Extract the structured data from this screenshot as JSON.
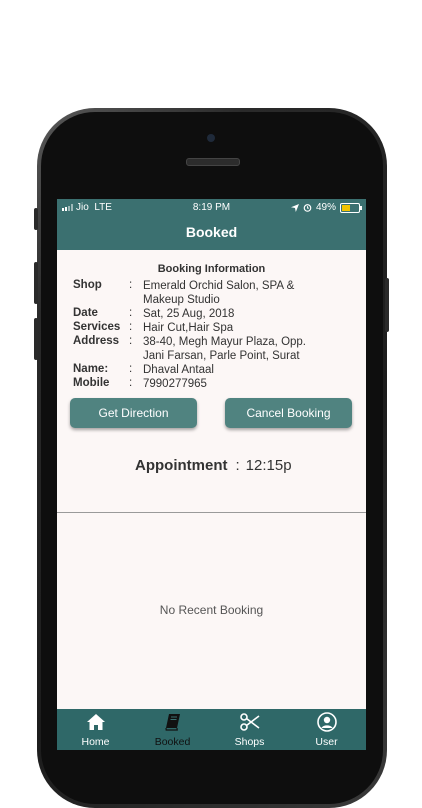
{
  "status": {
    "carrier": "Jio",
    "network": "LTE",
    "time": "8:19 PM",
    "battery": "49%",
    "battery_level": 0.49
  },
  "header": {
    "title": "Booked"
  },
  "booking": {
    "section_title": "Booking Information",
    "rows": [
      {
        "label": "Shop",
        "colon": ":",
        "value": "Emerald Orchid Salon, SPA & Makeup Studio"
      },
      {
        "label": "Date",
        "colon": ":",
        "value": "Sat, 25 Aug, 2018"
      },
      {
        "label": "Services",
        "colon": ":",
        "value": "Hair Cut,Hair Spa"
      },
      {
        "label": "Address",
        "colon": ":",
        "value": "38-40, Megh Mayur Plaza, Opp. Jani Farsan, Parle Point, Surat"
      },
      {
        "label": "Name:",
        "colon": ":",
        "value": "Dhaval Antaal"
      },
      {
        "label": "Mobile",
        "colon": ":",
        "value": "7990277965"
      }
    ],
    "get_direction_label": "Get Direction",
    "cancel_label": "Cancel Booking",
    "appointment_label": "Appointment",
    "appointment_sep": ":",
    "appointment_time": "12:15p"
  },
  "recent": {
    "empty_text": "No Recent Booking"
  },
  "tabs": [
    {
      "label": "Home",
      "icon": "home-icon"
    },
    {
      "label": "Booked",
      "icon": "book-icon"
    },
    {
      "label": "Shops",
      "icon": "scissors-icon"
    },
    {
      "label": "User",
      "icon": "user-icon"
    }
  ],
  "colors": {
    "primary": "#3b7070",
    "button": "#508380",
    "tabbar": "#2f6868",
    "background": "#fcf7f6"
  }
}
